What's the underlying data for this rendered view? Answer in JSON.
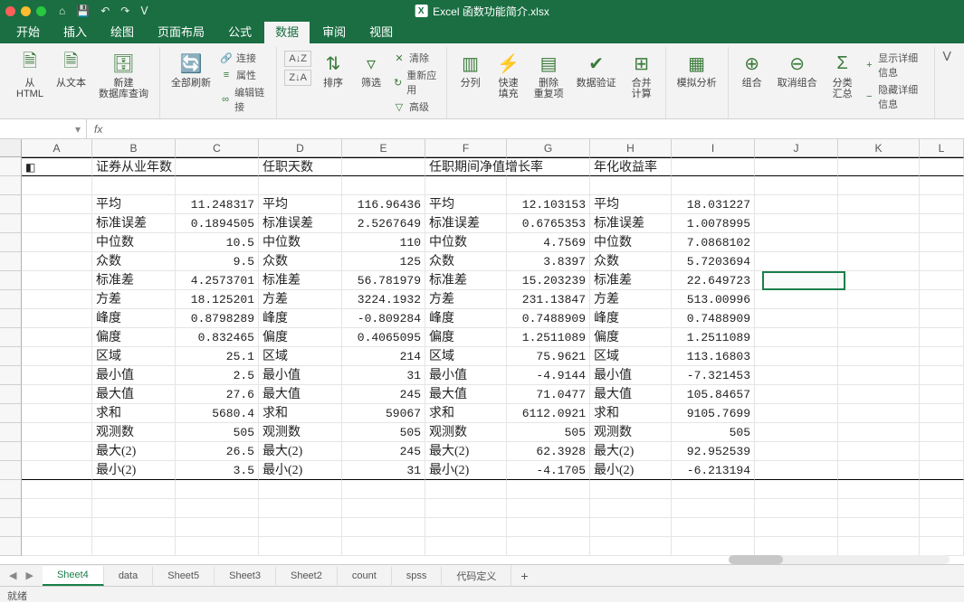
{
  "window": {
    "filename": "Excel 函数功能简介.xlsx"
  },
  "qat": {
    "save": "💾",
    "undo": "↶",
    "redo": "↷"
  },
  "tabs": {
    "items": [
      "开始",
      "插入",
      "绘图",
      "页面布局",
      "公式",
      "数据",
      "审阅",
      "视图"
    ],
    "active_index": 5
  },
  "ribbon": {
    "from_html": "从\nHTML",
    "from_text": "从文本",
    "new_db_query": "新建\n数据库查询",
    "refresh_all": "全部刷新",
    "connections": "连接",
    "properties": "属性",
    "edit_links": "编辑链接",
    "sort_az": "A↓Z",
    "sort_za": "Z↓A",
    "sort": "排序",
    "filter": "筛选",
    "clear": "清除",
    "reapply": "重新应用",
    "advanced": "高级",
    "text_to_cols": "分列",
    "flash_fill": "快速\n填充",
    "remove_dup": "删除\n重复项",
    "data_valid": "数据验证",
    "consolidate": "合并\n计算",
    "whatif": "模拟分析",
    "group": "组合",
    "ungroup": "取消组合",
    "subtotal": "分类\n汇总",
    "show_detail": "显示详细信息",
    "hide_detail": "隐藏详细信息"
  },
  "fbar": {
    "name": "",
    "fx": "fx",
    "formula": ""
  },
  "columns": [
    "A",
    "B",
    "C",
    "D",
    "E",
    "F",
    "G",
    "H",
    "I",
    "J",
    "K",
    "L"
  ],
  "headers": {
    "sec1": "证券从业年数",
    "sec2": "任职天数",
    "sec3": "任职期间净值增长率",
    "sec4": "年化收益率"
  },
  "stat_labels": {
    "mean": "平均",
    "stderr": "标准误差",
    "median": "中位数",
    "mode": "众数",
    "stdev": "标准差",
    "var": "方差",
    "kurt": "峰度",
    "skew": "偏度",
    "range": "区域",
    "min": "最小值",
    "max": "最大值",
    "sum": "求和",
    "count": "观测数",
    "max2": "最大(2)",
    "min2": "最小(2)"
  },
  "stats": [
    {
      "k": "mean",
      "v1": "11.248317",
      "v2": "116.96436",
      "v3": "12.103153",
      "v4": "18.031227"
    },
    {
      "k": "stderr",
      "v1": "0.1894505",
      "v2": "2.5267649",
      "v3": "0.6765353",
      "v4": "1.0078995"
    },
    {
      "k": "median",
      "v1": "10.5",
      "v2": "110",
      "v3": "4.7569",
      "v4": "7.0868102"
    },
    {
      "k": "mode",
      "v1": "9.5",
      "v2": "125",
      "v3": "3.8397",
      "v4": "5.7203694"
    },
    {
      "k": "stdev",
      "v1": "4.2573701",
      "v2": "56.781979",
      "v3": "15.203239",
      "v4": "22.649723"
    },
    {
      "k": "var",
      "v1": "18.125201",
      "v2": "3224.1932",
      "v3": "231.13847",
      "v4": "513.00996"
    },
    {
      "k": "kurt",
      "v1": "0.8798289",
      "v2": "-0.809284",
      "v3": "0.7488909",
      "v4": "0.7488909"
    },
    {
      "k": "skew",
      "v1": "0.832465",
      "v2": "0.4065095",
      "v3": "1.2511089",
      "v4": "1.2511089"
    },
    {
      "k": "range",
      "v1": "25.1",
      "v2": "214",
      "v3": "75.9621",
      "v4": "113.16803"
    },
    {
      "k": "min",
      "v1": "2.5",
      "v2": "31",
      "v3": "-4.9144",
      "v4": "-7.321453"
    },
    {
      "k": "max",
      "v1": "27.6",
      "v2": "245",
      "v3": "71.0477",
      "v4": "105.84657"
    },
    {
      "k": "sum",
      "v1": "5680.4",
      "v2": "59067",
      "v3": "6112.0921",
      "v4": "9105.7699"
    },
    {
      "k": "count",
      "v1": "505",
      "v2": "505",
      "v3": "505",
      "v4": "505"
    },
    {
      "k": "max2",
      "v1": "26.5",
      "v2": "245",
      "v3": "62.3928",
      "v4": "92.952539"
    },
    {
      "k": "min2",
      "v1": "3.5",
      "v2": "31",
      "v3": "-4.1705",
      "v4": "-6.213194"
    }
  ],
  "chart_data": {
    "type": "table",
    "series_names": [
      "证券从业年数",
      "任职天数",
      "任职期间净值增长率",
      "年化收益率"
    ],
    "statistics": [
      "平均",
      "标准误差",
      "中位数",
      "众数",
      "标准差",
      "方差",
      "峰度",
      "偏度",
      "区域",
      "最小值",
      "最大值",
      "求和",
      "观测数",
      "最大(2)",
      "最小(2)"
    ],
    "values": {
      "证券从业年数": [
        11.248317,
        0.1894505,
        10.5,
        9.5,
        4.2573701,
        18.125201,
        0.8798289,
        0.832465,
        25.1,
        2.5,
        27.6,
        5680.4,
        505,
        26.5,
        3.5
      ],
      "任职天数": [
        116.96436,
        2.5267649,
        110,
        125,
        56.781979,
        3224.1932,
        -0.809284,
        0.4065095,
        214,
        31,
        245,
        59067,
        505,
        245,
        31
      ],
      "任职期间净值增长率": [
        12.103153,
        0.6765353,
        4.7569,
        3.8397,
        15.203239,
        231.13847,
        0.7488909,
        1.2511089,
        75.9621,
        -4.9144,
        71.0477,
        6112.0921,
        505,
        62.3928,
        -4.1705
      ],
      "年化收益率": [
        18.031227,
        1.0078995,
        7.0868102,
        5.7203694,
        22.649723,
        513.00996,
        0.7488909,
        1.2511089,
        113.16803,
        -7.321453,
        105.84657,
        9105.7699,
        505,
        92.952539,
        -6.213194
      ]
    }
  },
  "sheets": {
    "items": [
      "Sheet4",
      "data",
      "Sheet5",
      "Sheet3",
      "Sheet2",
      "count",
      "spss",
      "代码定义"
    ],
    "active_index": 0
  },
  "status": {
    "ready": "就绪"
  }
}
